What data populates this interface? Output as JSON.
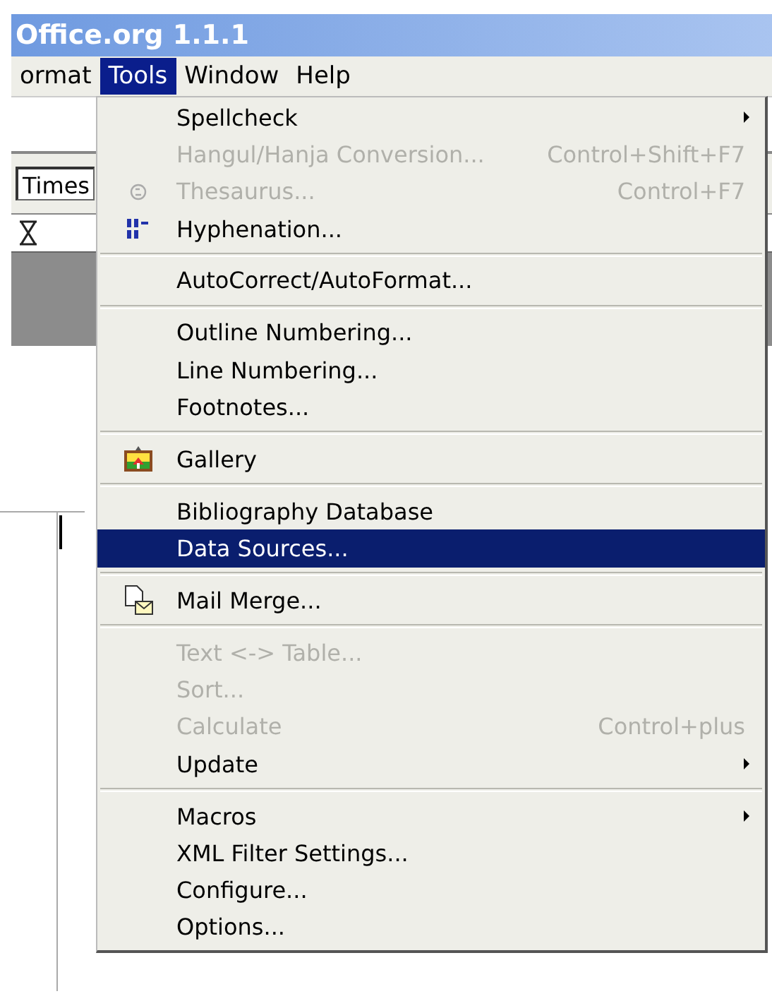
{
  "window": {
    "title": "Office.org 1.1.1"
  },
  "menubar": [
    {
      "label": "ormat",
      "selected": false
    },
    {
      "label": "Tools",
      "selected": true
    },
    {
      "label": "Window",
      "selected": false
    },
    {
      "label": "Help",
      "selected": false
    }
  ],
  "font_field": {
    "value": "Times"
  },
  "tools_menu": [
    {
      "kind": "item",
      "label": "Spellcheck",
      "submenu": true,
      "disabled": false,
      "selected": false
    },
    {
      "kind": "item",
      "label": "Hangul/Hanja Conversion...",
      "shortcut": "Control+Shift+F7",
      "disabled": true,
      "selected": false
    },
    {
      "kind": "thesaurus",
      "label": "Thesaurus...",
      "shortcut": "Control+F7",
      "disabled": true,
      "selected": false
    },
    {
      "kind": "hyphenation",
      "label": "Hyphenation...",
      "disabled": false,
      "selected": false
    },
    {
      "kind": "separator"
    },
    {
      "kind": "item",
      "label": "AutoCorrect/AutoFormat...",
      "disabled": false,
      "selected": false
    },
    {
      "kind": "separator"
    },
    {
      "kind": "item",
      "label": "Outline Numbering...",
      "disabled": false,
      "selected": false
    },
    {
      "kind": "item",
      "label": "Line Numbering...",
      "disabled": false,
      "selected": false
    },
    {
      "kind": "item",
      "label": "Footnotes...",
      "disabled": false,
      "selected": false
    },
    {
      "kind": "separator"
    },
    {
      "kind": "gallery",
      "label": "Gallery",
      "disabled": false,
      "selected": false
    },
    {
      "kind": "separator"
    },
    {
      "kind": "item",
      "label": "Bibliography Database",
      "disabled": false,
      "selected": false
    },
    {
      "kind": "item",
      "label": "Data Sources...",
      "disabled": false,
      "selected": true
    },
    {
      "kind": "separator"
    },
    {
      "kind": "mail",
      "label": "Mail Merge...",
      "disabled": false,
      "selected": false
    },
    {
      "kind": "separator"
    },
    {
      "kind": "item",
      "label": "Text <-> Table...",
      "disabled": true,
      "selected": false
    },
    {
      "kind": "item",
      "label": "Sort...",
      "disabled": true,
      "selected": false
    },
    {
      "kind": "item",
      "label": "Calculate",
      "shortcut": "Control+plus",
      "disabled": true,
      "selected": false
    },
    {
      "kind": "item",
      "label": "Update",
      "submenu": true,
      "disabled": false,
      "selected": false
    },
    {
      "kind": "separator"
    },
    {
      "kind": "item",
      "label": "Macros",
      "submenu": true,
      "disabled": false,
      "selected": false
    },
    {
      "kind": "item",
      "label": "XML Filter Settings...",
      "disabled": false,
      "selected": false
    },
    {
      "kind": "item",
      "label": "Configure...",
      "disabled": false,
      "selected": false
    },
    {
      "kind": "item",
      "label": "Options...",
      "disabled": false,
      "selected": false
    }
  ]
}
